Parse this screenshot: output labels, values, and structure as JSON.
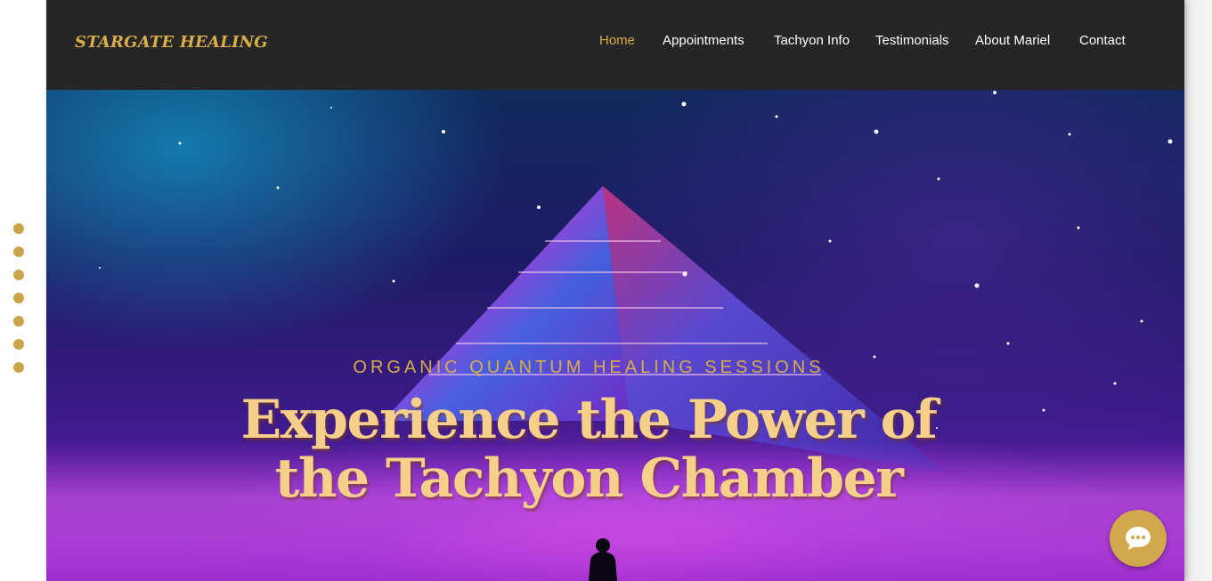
{
  "header": {
    "logo": "STARGATE HEALING",
    "nav": [
      {
        "label": "Home",
        "active": true
      },
      {
        "label": "Appointments",
        "active": false
      },
      {
        "label": "Tachyon Info",
        "active": false
      },
      {
        "label": "Testimonials",
        "active": false
      },
      {
        "label": "About Mariel",
        "active": false
      },
      {
        "label": "Contact",
        "active": false
      }
    ]
  },
  "hero": {
    "kicker": "ORGANIC QUANTUM HEALING SESSIONS",
    "headline_line1": "Experience the Power of",
    "headline_line2": "the Tachyon Chamber"
  },
  "section_dots": {
    "count": 7
  },
  "chat": {
    "icon": "chat-bubble-icon"
  },
  "colors": {
    "accent_gold": "#d9ad47",
    "header_bg": "#262626",
    "headline": "#f6d08a",
    "chat_button": "#d2a84c"
  }
}
